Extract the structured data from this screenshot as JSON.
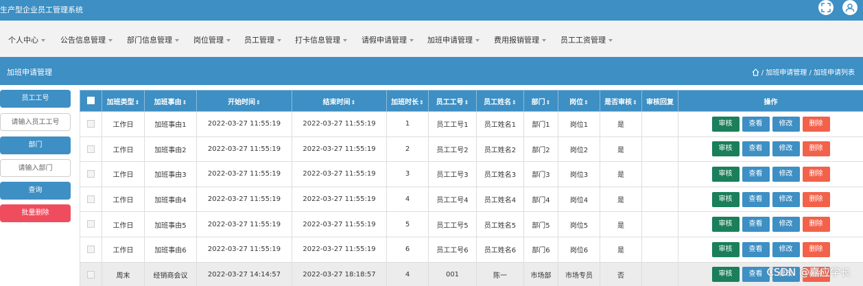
{
  "app": {
    "title": "生产型企业员工管理系统"
  },
  "nav": [
    {
      "label": "个人中心"
    },
    {
      "label": "公告信息管理"
    },
    {
      "label": "部门信息管理"
    },
    {
      "label": "岗位管理"
    },
    {
      "label": "员工管理"
    },
    {
      "label": "打卡信息管理"
    },
    {
      "label": "请假申请管理"
    },
    {
      "label": "加班申请管理"
    },
    {
      "label": "费用报销管理"
    },
    {
      "label": "员工工资管理"
    }
  ],
  "page": {
    "title": "加班申请管理",
    "breadcrumb": "/ 加班申请管理 / 加班申请列表"
  },
  "sidebar": {
    "emp_no_label": "员工工号",
    "emp_no_placeholder": "请输入员工工号",
    "dept_label": "部门",
    "dept_placeholder": "请输入部门",
    "search_label": "查询",
    "batch_delete_label": "批量删除"
  },
  "table": {
    "headers": [
      "加班类型",
      "加班事由",
      "开始时间",
      "结束时间",
      "加班时长",
      "员工工号",
      "员工姓名",
      "部门",
      "岗位",
      "是否审核",
      "审核回复",
      "操作"
    ],
    "actions": {
      "review": "审核",
      "view": "查看",
      "edit": "修改",
      "delete": "删除"
    },
    "rows": [
      [
        "工作日",
        "加班事由1",
        "2022-03-27 11:55:19",
        "2022-03-27 11:55:19",
        "1",
        "员工工号1",
        "员工姓名1",
        "部门1",
        "岗位1",
        "是",
        ""
      ],
      [
        "工作日",
        "加班事由2",
        "2022-03-27 11:55:19",
        "2022-03-27 11:55:19",
        "2",
        "员工工号2",
        "员工姓名2",
        "部门2",
        "岗位2",
        "是",
        ""
      ],
      [
        "工作日",
        "加班事由3",
        "2022-03-27 11:55:19",
        "2022-03-27 11:55:19",
        "3",
        "员工工号3",
        "员工姓名3",
        "部门3",
        "岗位3",
        "是",
        ""
      ],
      [
        "工作日",
        "加班事由4",
        "2022-03-27 11:55:19",
        "2022-03-27 11:55:19",
        "4",
        "员工工号4",
        "员工姓名4",
        "部门4",
        "岗位4",
        "是",
        ""
      ],
      [
        "工作日",
        "加班事由5",
        "2022-03-27 11:55:19",
        "2022-03-27 11:55:19",
        "5",
        "员工工号5",
        "员工姓名5",
        "部门5",
        "岗位5",
        "是",
        ""
      ],
      [
        "工作日",
        "加班事由6",
        "2022-03-27 11:55:19",
        "2022-03-27 11:55:19",
        "6",
        "员工工号6",
        "员工姓名6",
        "部门6",
        "岗位6",
        "是",
        ""
      ],
      [
        "周末",
        "经销商会议",
        "2022-03-27 14:14:57",
        "2022-03-27 18:18:57",
        "4",
        "001",
        "陈一",
        "市场部",
        "市场专员",
        "否",
        ""
      ]
    ]
  },
  "watermark": "CSDN @嘉应学长",
  "colors": {
    "primary": "#3d8fc4",
    "review": "#1a7f5a",
    "delete": "#f2614a",
    "batch_delete": "#ef4d5e"
  }
}
